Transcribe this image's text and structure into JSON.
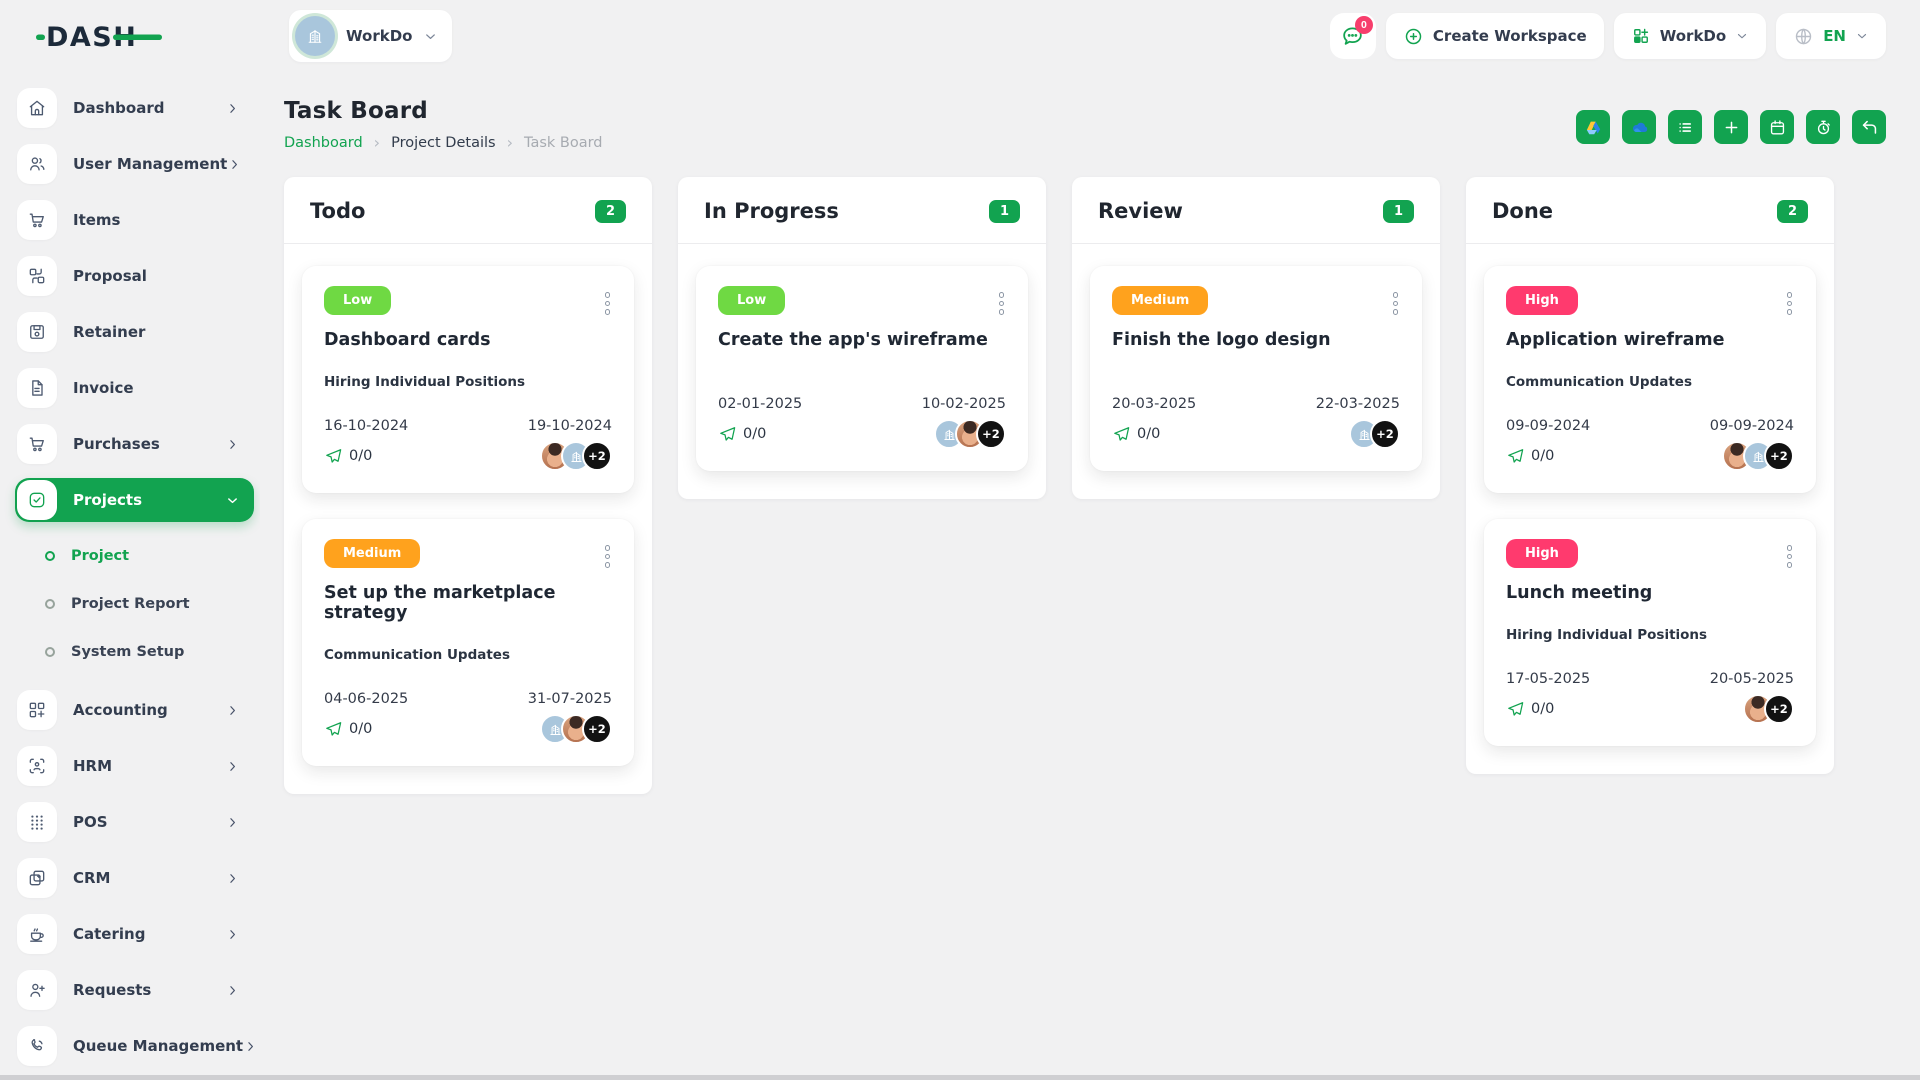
{
  "colors": {
    "accent": "#12a350",
    "lime": "#6fd943",
    "orange": "#ffa21d",
    "pink": "#ff3a6e",
    "badge-pink": "#f73e6c",
    "page-bg": "#f1f1f2"
  },
  "brand": {
    "logo_text": "DASH"
  },
  "topbar": {
    "workspace_label": "WorkDo",
    "messages_badge": "0",
    "create_workspace_label": "Create Workspace",
    "workspace_menu_label": "WorkDo",
    "language": "EN"
  },
  "sidebar": {
    "items": [
      {
        "label": "Dashboard",
        "icon": "home",
        "chevron": "right"
      },
      {
        "label": "User Management",
        "icon": "users",
        "chevron": "right"
      },
      {
        "label": "Items",
        "icon": "cart"
      },
      {
        "label": "Proposal",
        "icon": "proposal"
      },
      {
        "label": "Retainer",
        "icon": "retainer"
      },
      {
        "label": "Invoice",
        "icon": "invoice"
      },
      {
        "label": "Purchases",
        "icon": "cart",
        "chevron": "right"
      },
      {
        "label": "Projects",
        "icon": "projects",
        "chevron": "down",
        "active": true,
        "children": [
          {
            "label": "Project",
            "active": true
          },
          {
            "label": "Project Report"
          },
          {
            "label": "System Setup"
          }
        ]
      },
      {
        "label": "Accounting",
        "icon": "accounting",
        "chevron": "right"
      },
      {
        "label": "HRM",
        "icon": "hrm",
        "chevron": "right"
      },
      {
        "label": "POS",
        "icon": "pos",
        "chevron": "right"
      },
      {
        "label": "CRM",
        "icon": "crm",
        "chevron": "right"
      },
      {
        "label": "Catering",
        "icon": "catering",
        "chevron": "right"
      },
      {
        "label": "Requests",
        "icon": "requests",
        "chevron": "right"
      },
      {
        "label": "Queue Management",
        "icon": "queue",
        "chevron": "right"
      }
    ]
  },
  "page": {
    "title": "Task Board",
    "breadcrumb": [
      "Dashboard",
      "Project Details",
      "Task Board"
    ]
  },
  "toolbar": {
    "buttons": [
      {
        "name": "google-drive"
      },
      {
        "name": "onedrive"
      },
      {
        "name": "list"
      },
      {
        "name": "add"
      },
      {
        "name": "calendar"
      },
      {
        "name": "timer"
      },
      {
        "name": "undo"
      }
    ]
  },
  "board": {
    "columns": [
      {
        "title": "Todo",
        "count": "2",
        "cards": [
          {
            "priority": "Low",
            "priority_color": "#6fd943",
            "title": "Dashboard cards",
            "milestone": "Hiring Individual Positions",
            "start_date": "16-10-2024",
            "end_date": "19-10-2024",
            "task_count": "0/0",
            "members": [
              "photo",
              "logo",
              "+2"
            ]
          },
          {
            "priority": "Medium",
            "priority_color": "#ffa21d",
            "title": "Set up the marketplace strategy",
            "milestone": "Communication Updates",
            "start_date": "04-06-2025",
            "end_date": "31-07-2025",
            "task_count": "0/0",
            "members": [
              "logo",
              "photo",
              "+2"
            ]
          }
        ]
      },
      {
        "title": "In Progress",
        "count": "1",
        "cards": [
          {
            "priority": "Low",
            "priority_color": "#6fd943",
            "title": "Create the app's wireframe",
            "milestone": "",
            "start_date": "02-01-2025",
            "end_date": "10-02-2025",
            "task_count": "0/0",
            "members": [
              "logo",
              "photo",
              "+2"
            ]
          }
        ]
      },
      {
        "title": "Review",
        "count": "1",
        "cards": [
          {
            "priority": "Medium",
            "priority_color": "#ffa21d",
            "title": "Finish the logo design",
            "milestone": "",
            "start_date": "20-03-2025",
            "end_date": "22-03-2025",
            "task_count": "0/0",
            "members": [
              "logo",
              "+2"
            ]
          }
        ]
      },
      {
        "title": "Done",
        "count": "2",
        "cards": [
          {
            "priority": "High",
            "priority_color": "#ff3a6e",
            "title": "Application wireframe",
            "milestone": "Communication Updates",
            "start_date": "09-09-2024",
            "end_date": "09-09-2024",
            "task_count": "0/0",
            "members": [
              "photo",
              "logo",
              "+2"
            ]
          },
          {
            "priority": "High",
            "priority_color": "#ff3a6e",
            "title": "Lunch meeting",
            "milestone": "Hiring Individual Positions",
            "start_date": "17-05-2025",
            "end_date": "20-05-2025",
            "task_count": "0/0",
            "members": [
              "photo",
              "+2"
            ]
          }
        ]
      }
    ]
  }
}
